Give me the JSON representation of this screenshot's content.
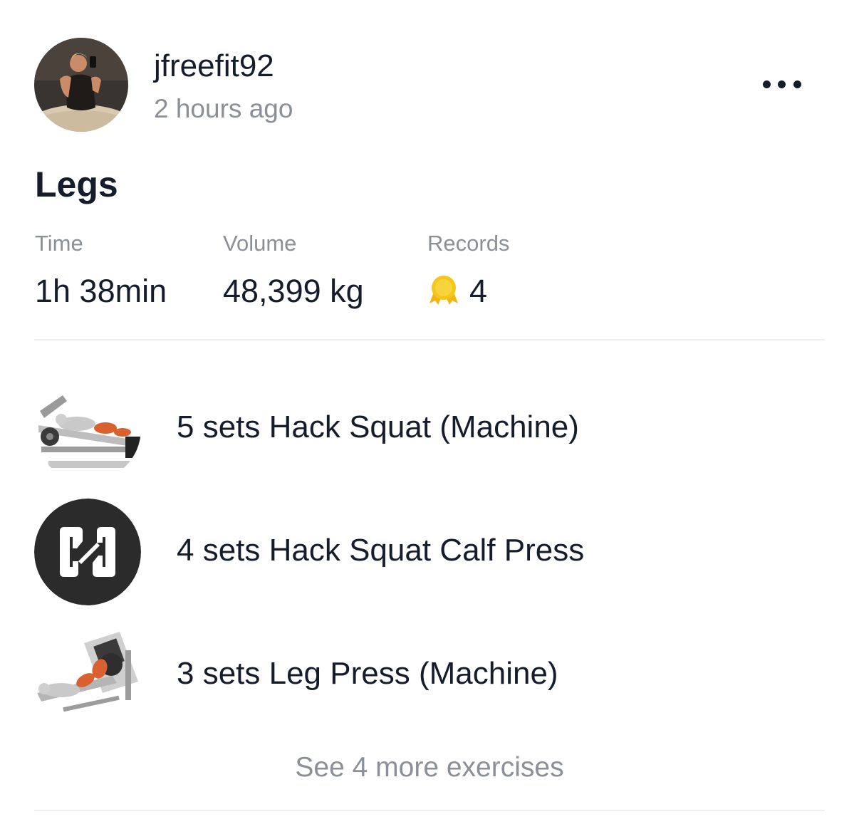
{
  "post": {
    "username": "jfreefit92",
    "timestamp": "2 hours ago",
    "avatar_icon": "user-avatar-photo",
    "more_icon": "ellipsis-icon"
  },
  "workout": {
    "title": "Legs",
    "stats": {
      "time_label": "Time",
      "time_value": "1h 38min",
      "volume_label": "Volume",
      "volume_value": "48,399 kg",
      "records_label": "Records",
      "records_value": "4",
      "records_icon": "medal-icon",
      "medal_color": "#f5c518"
    }
  },
  "exercises": [
    {
      "label": "5 sets Hack Squat (Machine)",
      "icon": "hack-squat-illustration"
    },
    {
      "label": "4 sets Hack Squat Calf Press",
      "icon": "app-logo-icon"
    },
    {
      "label": "3 sets Leg Press (Machine)",
      "icon": "leg-press-illustration"
    }
  ],
  "see_more_label": "See 4 more exercises",
  "colors": {
    "text_primary": "#151c2b",
    "text_secondary": "#8a8f98",
    "divider": "#eeeff1",
    "logo_bg": "#2b2b2b",
    "muscle_highlight": "#d9602f"
  }
}
